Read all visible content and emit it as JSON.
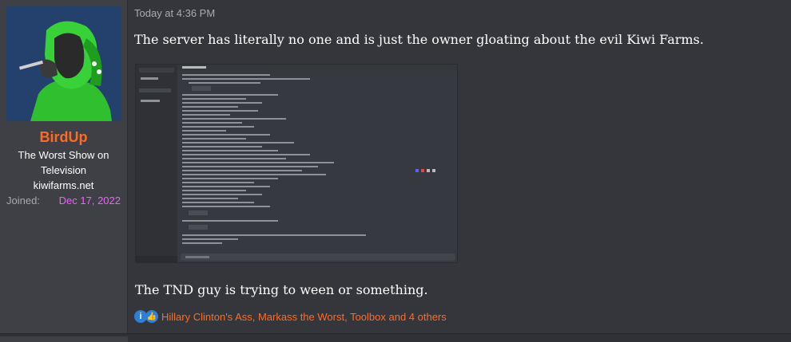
{
  "user": {
    "name": "BirdUp",
    "title": "The Worst Show on Television",
    "site": "kiwifarms.net",
    "joined_label": "Joined:",
    "joined_date": "Dec 17, 2022"
  },
  "post": {
    "timestamp": "Today at 4:36 PM",
    "message": "The server has literally no one and is just the owner gloating about the evil Kiwi Farms.",
    "message2": "The TND guy is trying to ween or something.",
    "reactions_text": "Hillary Clinton's Ass, Markass the Worst, Toolbox and 4 others"
  },
  "colors": {
    "accent": "#ff6a25",
    "joined": "#f15fff",
    "background": "#34363b",
    "sidebar": "#3e4046"
  }
}
